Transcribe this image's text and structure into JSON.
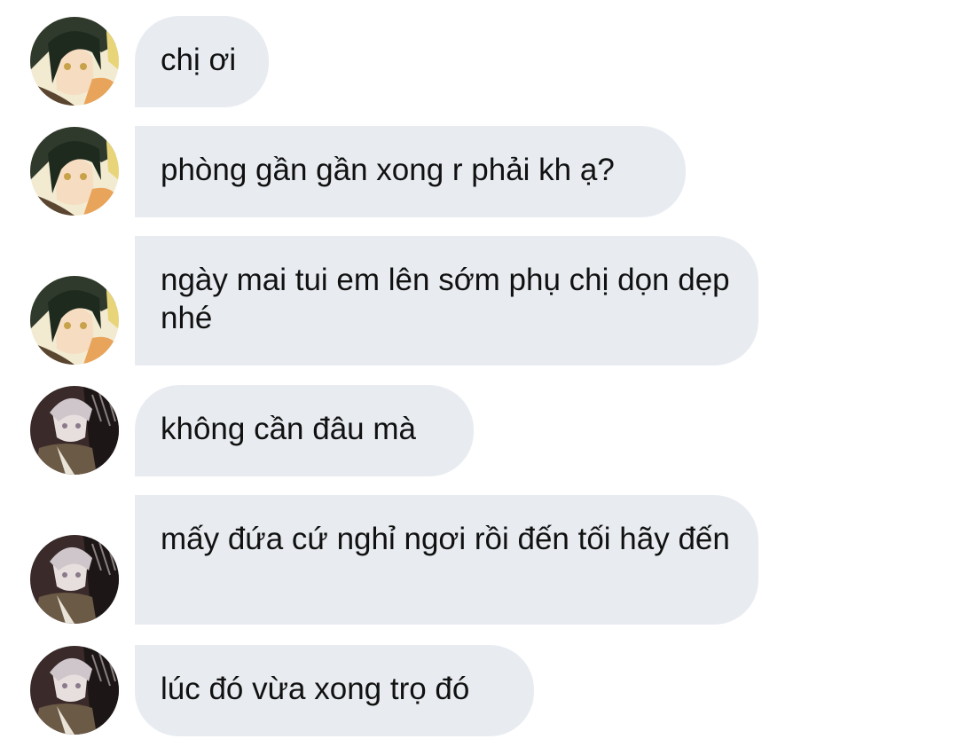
{
  "conversation": {
    "messages": [
      {
        "sender": "girl",
        "text": "chị ơi"
      },
      {
        "sender": "girl",
        "text": "phòng gần gần xong r phải kh ạ?"
      },
      {
        "sender": "girl",
        "text": "ngày mai tui em lên sớm phụ chị dọn dẹp nhé"
      },
      {
        "sender": "boy",
        "text": "không cần đâu mà"
      },
      {
        "sender": "boy",
        "text": "mấy đứa cứ nghỉ ngơi rồi đến tối hãy đến"
      },
      {
        "sender": "boy",
        "text": "lúc đó vừa xong trọ đó"
      }
    ]
  },
  "colors": {
    "bubble": "#e8ecf1",
    "text": "#111111",
    "background": "#ffffff"
  },
  "icons": {
    "avatar_1": "green-haired-character-avatar-icon",
    "avatar_2": "silver-haired-character-avatar-icon"
  }
}
